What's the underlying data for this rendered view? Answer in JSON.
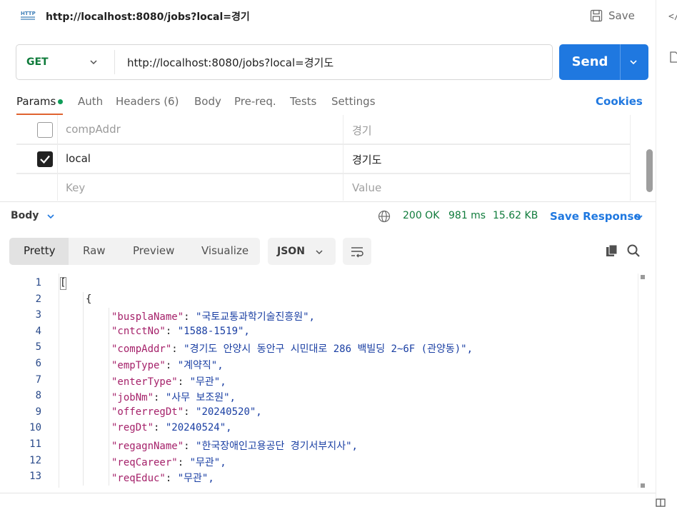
{
  "request": {
    "title": "http://localhost:8080/jobs?local=경기",
    "save_label": "Save",
    "method": "GET",
    "url": "http://localhost:8080/jobs?local=경기도",
    "send_label": "Send"
  },
  "tabs": {
    "params": "Params",
    "auth": "Auth",
    "headers": "Headers (6)",
    "body": "Body",
    "prereq": "Pre-req.",
    "tests": "Tests",
    "settings": "Settings",
    "cookies": "Cookies"
  },
  "params": {
    "rows": [
      {
        "checked": false,
        "key": "compAddr",
        "value": "경기"
      },
      {
        "checked": true,
        "key": "local",
        "value": "경기도"
      }
    ],
    "key_placeholder": "Key",
    "value_placeholder": "Value"
  },
  "response": {
    "body_label": "Body",
    "status": "200 OK",
    "time": "981 ms",
    "size": "15.62 KB",
    "save_label": "Save Response",
    "views": [
      "Pretty",
      "Raw",
      "Preview",
      "Visualize"
    ],
    "format": "JSON"
  },
  "code_lines": [
    {
      "n": "1",
      "indent": 0,
      "text": "["
    },
    {
      "n": "2",
      "indent": 1,
      "text": "{"
    },
    {
      "n": "3",
      "indent": 2,
      "key": "busplaName",
      "value": "\"국토교통과학기술진흥원\","
    },
    {
      "n": "4",
      "indent": 2,
      "key": "cntctNo",
      "value": "\"1588-1519\","
    },
    {
      "n": "5",
      "indent": 2,
      "key": "compAddr",
      "value": "\"경기도 안양시 동안구 시민대로 286 백빌딩 2~6F (관양동)\","
    },
    {
      "n": "6",
      "indent": 2,
      "key": "empType",
      "value": "\"계약직\","
    },
    {
      "n": "7",
      "indent": 2,
      "key": "enterType",
      "value": "\"무관\","
    },
    {
      "n": "8",
      "indent": 2,
      "key": "jobNm",
      "value": "\"사무 보조원\","
    },
    {
      "n": "9",
      "indent": 2,
      "key": "offerregDt",
      "value": "\"20240520\","
    },
    {
      "n": "10",
      "indent": 2,
      "key": "regDt",
      "value": "\"20240524\","
    },
    {
      "n": "11",
      "indent": 2,
      "key": "regagnName",
      "value": "\"한국장애인고용공단 경기서부지사\","
    },
    {
      "n": "12",
      "indent": 2,
      "key": "reqCareer",
      "value": "\"무관\","
    },
    {
      "n": "13",
      "indent": 2,
      "key": "reqEduc",
      "value": "\"무관\","
    }
  ],
  "colors": {
    "accent": "#1f78e0",
    "method_green": "#0f7b3b",
    "json_key": "#a5216a",
    "json_string": "#1a3fa3",
    "tab_underline": "#e06330"
  }
}
